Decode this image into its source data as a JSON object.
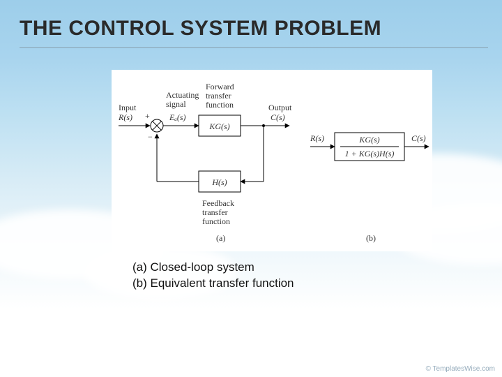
{
  "title": "THE CONTROL SYSTEM PROBLEM",
  "fig_a": {
    "input_label_top": "Input",
    "input_label_bot": "R(s)",
    "actuating_top": "Actuating",
    "actuating_mid": "signal",
    "actuating_sym": "Eₐ(s)",
    "forward_top": "Forward",
    "forward_mid": "transfer",
    "forward_bot": "function",
    "forward_block": "KG(s)",
    "output_top": "Output",
    "output_bot": "C(s)",
    "feedback_block": "H(s)",
    "feedback_top": "Feedback",
    "feedback_mid": "transfer",
    "feedback_bot": "function",
    "plus": "+",
    "minus": "−",
    "tag": "(a)"
  },
  "fig_b": {
    "input": "R(s)",
    "tf_num": "KG(s)",
    "tf_den": "1 + KG(s)H(s)",
    "output": "C(s)",
    "tag": "(b)"
  },
  "captions": {
    "a": "(a) Closed-loop system",
    "b": "(b) Equivalent transfer function"
  },
  "watermark": "© TemplatesWise.com"
}
